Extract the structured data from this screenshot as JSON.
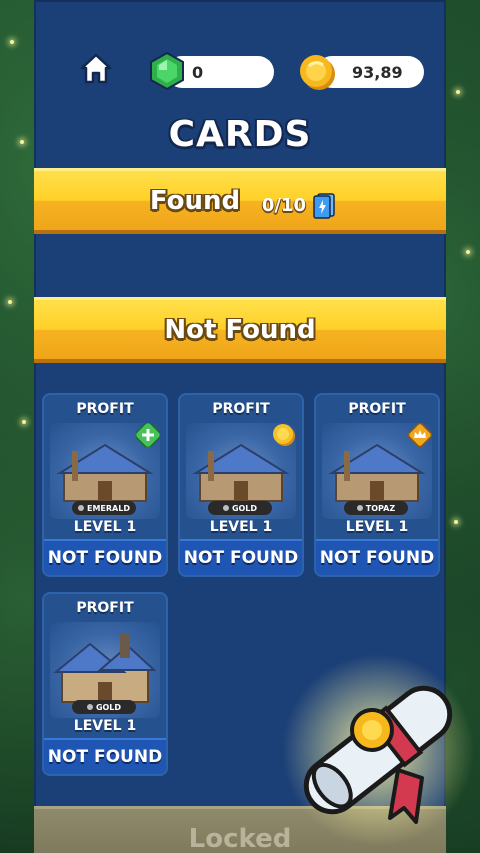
{
  "header": {
    "gems": "0",
    "coins": "93,89",
    "title": "CARDS"
  },
  "found_section": {
    "label": "Found",
    "count": "0/10"
  },
  "not_found_section": {
    "label": "Not Found",
    "cards": [
      {
        "label": "PROFIT",
        "tier": "EMERALD",
        "level": "LEVEL 1",
        "status": "NOT FOUND",
        "badge": "emerald-plus-icon"
      },
      {
        "label": "PROFIT",
        "tier": "GOLD",
        "level": "LEVEL 1",
        "status": "NOT FOUND",
        "badge": "gold-coin-icon"
      },
      {
        "label": "PROFIT",
        "tier": "TOPAZ",
        "level": "LEVEL 1",
        "status": "NOT FOUND",
        "badge": "crown-icon"
      },
      {
        "label": "PROFIT",
        "tier": "GOLD",
        "level": "LEVEL 1",
        "status": "NOT FOUND",
        "badge": ""
      }
    ]
  },
  "locked_section": {
    "label": "Locked"
  },
  "colors": {
    "panel": "#1b3f77",
    "band_yellow": "#ffd028",
    "button_blue": "#1f56b4",
    "gem_green": "#38c95a",
    "coin_gold": "#f7b81e"
  }
}
